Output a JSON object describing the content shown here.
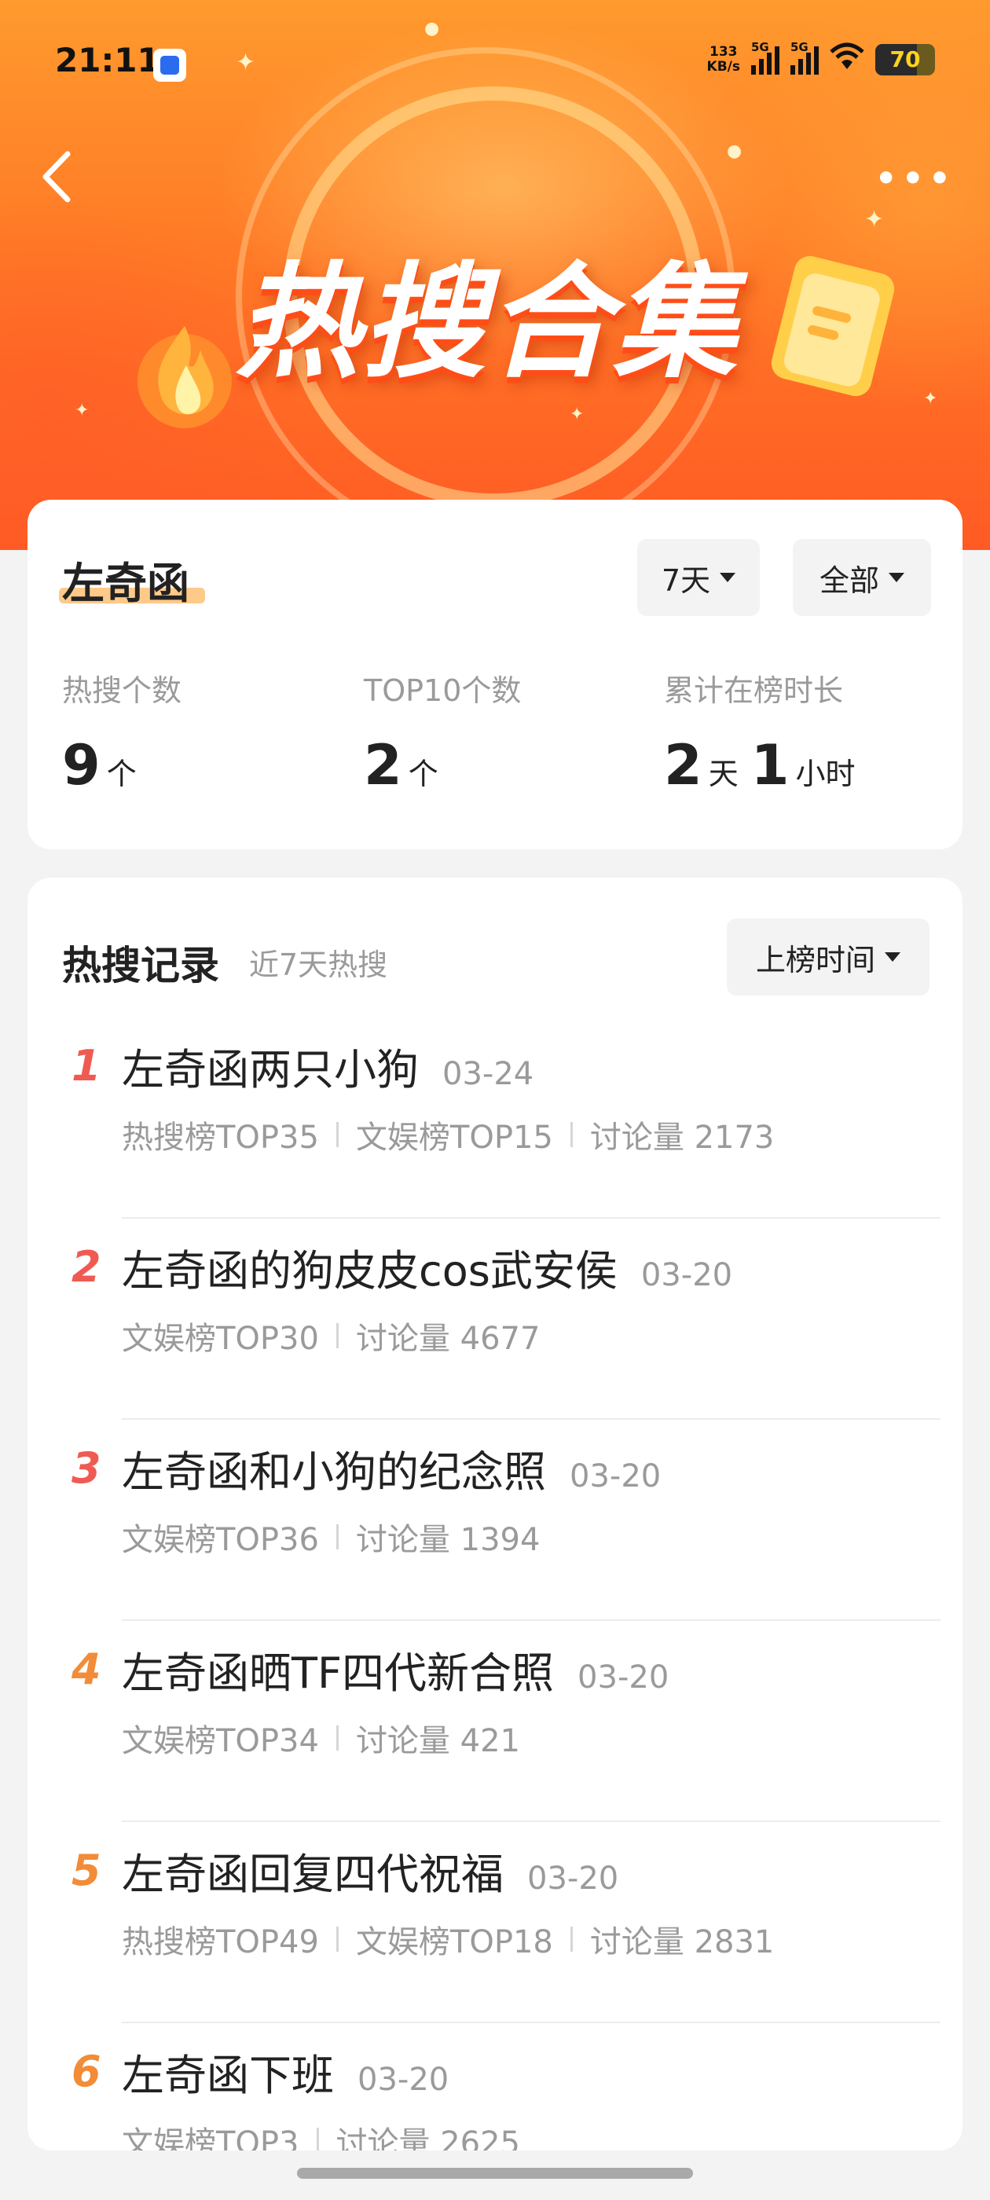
{
  "status_bar": {
    "time": "21:11",
    "net_speed_value": "133",
    "net_speed_unit": "KB/s",
    "signal1_label": "5G",
    "signal2_label": "5G",
    "battery": "70",
    "battery_level": 0.7
  },
  "header": {
    "banner_title": "热搜合集",
    "back_icon": "chevron-left-icon",
    "more_icon": "more-dots-icon"
  },
  "profile": {
    "name": "左奇函",
    "period_filter": "7天",
    "category_filter": "全部",
    "stats": [
      {
        "label": "热搜个数",
        "value": "9",
        "unit": "个"
      },
      {
        "label": "TOP10个数",
        "value": "2",
        "unit": "个"
      },
      {
        "label": "累计在榜时长",
        "value1": "2",
        "unit1": "天",
        "value2": "1",
        "unit2": "小时"
      }
    ]
  },
  "records": {
    "title": "热搜记录",
    "subtitle": "近7天热搜",
    "sort_label": "上榜时间",
    "items": [
      {
        "rank": "1",
        "rank_color": "#ef5b52",
        "title": "左奇函两只小狗",
        "date": "03-24",
        "meta": [
          "热搜榜TOP35",
          "文娱榜TOP15",
          "讨论量 2173"
        ]
      },
      {
        "rank": "2",
        "rank_color": "#ef5b52",
        "title": "左奇函的狗皮皮cos武安侯",
        "date": "03-20",
        "meta": [
          "文娱榜TOP30",
          "讨论量 4677"
        ]
      },
      {
        "rank": "3",
        "rank_color": "#ef5b52",
        "title": "左奇函和小狗的纪念照",
        "date": "03-20",
        "meta": [
          "文娱榜TOP36",
          "讨论量 1394"
        ]
      },
      {
        "rank": "4",
        "rank_color": "#f28c38",
        "title": "左奇函晒TF四代新合照",
        "date": "03-20",
        "meta": [
          "文娱榜TOP34",
          "讨论量 421"
        ]
      },
      {
        "rank": "5",
        "rank_color": "#f28c38",
        "title": "左奇函回复四代祝福",
        "date": "03-20",
        "meta": [
          "热搜榜TOP49",
          "文娱榜TOP18",
          "讨论量 2831"
        ]
      },
      {
        "rank": "6",
        "rank_color": "#f28c38",
        "title": "左奇函下班",
        "date": "03-20",
        "meta": [
          "文娱榜TOP3",
          "讨论量 2625"
        ]
      }
    ]
  }
}
